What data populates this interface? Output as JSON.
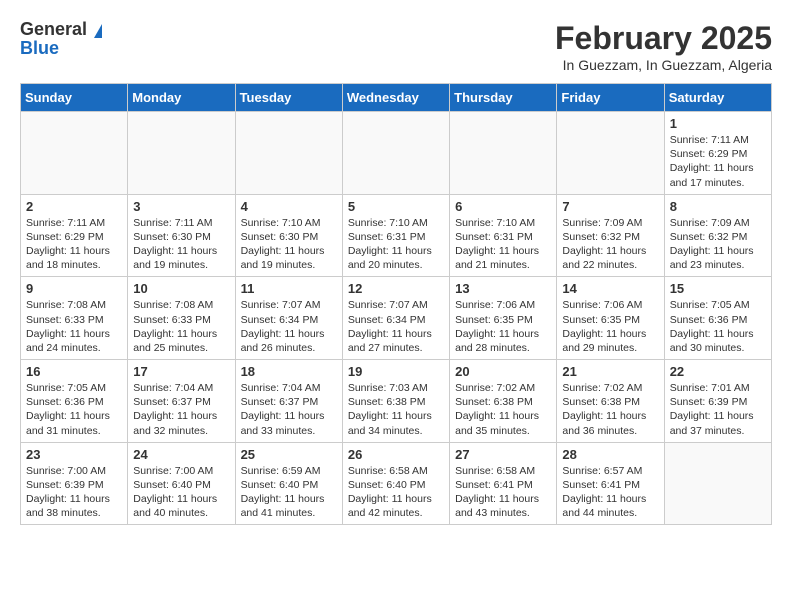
{
  "logo": {
    "general": "General",
    "blue": "Blue"
  },
  "title": "February 2025",
  "subtitle": "In Guezzam, In Guezzam, Algeria",
  "weekdays": [
    "Sunday",
    "Monday",
    "Tuesday",
    "Wednesday",
    "Thursday",
    "Friday",
    "Saturday"
  ],
  "weeks": [
    [
      {
        "day": "",
        "info": ""
      },
      {
        "day": "",
        "info": ""
      },
      {
        "day": "",
        "info": ""
      },
      {
        "day": "",
        "info": ""
      },
      {
        "day": "",
        "info": ""
      },
      {
        "day": "",
        "info": ""
      },
      {
        "day": "1",
        "info": "Sunrise: 7:11 AM\nSunset: 6:29 PM\nDaylight: 11 hours and 17 minutes."
      }
    ],
    [
      {
        "day": "2",
        "info": "Sunrise: 7:11 AM\nSunset: 6:29 PM\nDaylight: 11 hours and 18 minutes."
      },
      {
        "day": "3",
        "info": "Sunrise: 7:11 AM\nSunset: 6:30 PM\nDaylight: 11 hours and 19 minutes."
      },
      {
        "day": "4",
        "info": "Sunrise: 7:10 AM\nSunset: 6:30 PM\nDaylight: 11 hours and 19 minutes."
      },
      {
        "day": "5",
        "info": "Sunrise: 7:10 AM\nSunset: 6:31 PM\nDaylight: 11 hours and 20 minutes."
      },
      {
        "day": "6",
        "info": "Sunrise: 7:10 AM\nSunset: 6:31 PM\nDaylight: 11 hours and 21 minutes."
      },
      {
        "day": "7",
        "info": "Sunrise: 7:09 AM\nSunset: 6:32 PM\nDaylight: 11 hours and 22 minutes."
      },
      {
        "day": "8",
        "info": "Sunrise: 7:09 AM\nSunset: 6:32 PM\nDaylight: 11 hours and 23 minutes."
      }
    ],
    [
      {
        "day": "9",
        "info": "Sunrise: 7:08 AM\nSunset: 6:33 PM\nDaylight: 11 hours and 24 minutes."
      },
      {
        "day": "10",
        "info": "Sunrise: 7:08 AM\nSunset: 6:33 PM\nDaylight: 11 hours and 25 minutes."
      },
      {
        "day": "11",
        "info": "Sunrise: 7:07 AM\nSunset: 6:34 PM\nDaylight: 11 hours and 26 minutes."
      },
      {
        "day": "12",
        "info": "Sunrise: 7:07 AM\nSunset: 6:34 PM\nDaylight: 11 hours and 27 minutes."
      },
      {
        "day": "13",
        "info": "Sunrise: 7:06 AM\nSunset: 6:35 PM\nDaylight: 11 hours and 28 minutes."
      },
      {
        "day": "14",
        "info": "Sunrise: 7:06 AM\nSunset: 6:35 PM\nDaylight: 11 hours and 29 minutes."
      },
      {
        "day": "15",
        "info": "Sunrise: 7:05 AM\nSunset: 6:36 PM\nDaylight: 11 hours and 30 minutes."
      }
    ],
    [
      {
        "day": "16",
        "info": "Sunrise: 7:05 AM\nSunset: 6:36 PM\nDaylight: 11 hours and 31 minutes."
      },
      {
        "day": "17",
        "info": "Sunrise: 7:04 AM\nSunset: 6:37 PM\nDaylight: 11 hours and 32 minutes."
      },
      {
        "day": "18",
        "info": "Sunrise: 7:04 AM\nSunset: 6:37 PM\nDaylight: 11 hours and 33 minutes."
      },
      {
        "day": "19",
        "info": "Sunrise: 7:03 AM\nSunset: 6:38 PM\nDaylight: 11 hours and 34 minutes."
      },
      {
        "day": "20",
        "info": "Sunrise: 7:02 AM\nSunset: 6:38 PM\nDaylight: 11 hours and 35 minutes."
      },
      {
        "day": "21",
        "info": "Sunrise: 7:02 AM\nSunset: 6:38 PM\nDaylight: 11 hours and 36 minutes."
      },
      {
        "day": "22",
        "info": "Sunrise: 7:01 AM\nSunset: 6:39 PM\nDaylight: 11 hours and 37 minutes."
      }
    ],
    [
      {
        "day": "23",
        "info": "Sunrise: 7:00 AM\nSunset: 6:39 PM\nDaylight: 11 hours and 38 minutes."
      },
      {
        "day": "24",
        "info": "Sunrise: 7:00 AM\nSunset: 6:40 PM\nDaylight: 11 hours and 40 minutes."
      },
      {
        "day": "25",
        "info": "Sunrise: 6:59 AM\nSunset: 6:40 PM\nDaylight: 11 hours and 41 minutes."
      },
      {
        "day": "26",
        "info": "Sunrise: 6:58 AM\nSunset: 6:40 PM\nDaylight: 11 hours and 42 minutes."
      },
      {
        "day": "27",
        "info": "Sunrise: 6:58 AM\nSunset: 6:41 PM\nDaylight: 11 hours and 43 minutes."
      },
      {
        "day": "28",
        "info": "Sunrise: 6:57 AM\nSunset: 6:41 PM\nDaylight: 11 hours and 44 minutes."
      },
      {
        "day": "",
        "info": ""
      }
    ]
  ]
}
